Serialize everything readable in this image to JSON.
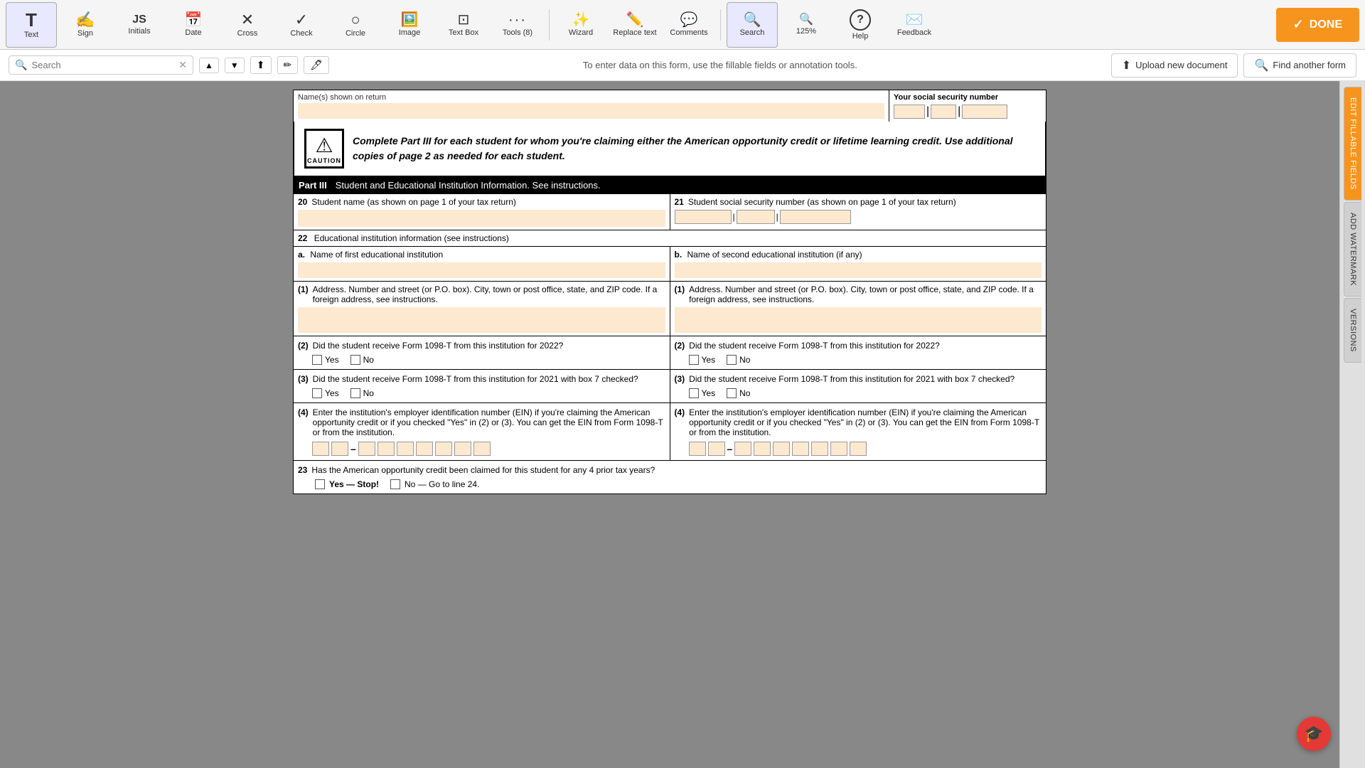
{
  "toolbar": {
    "tools": [
      {
        "id": "text",
        "label": "Text",
        "icon": "T",
        "active": true
      },
      {
        "id": "sign",
        "label": "Sign",
        "icon": "✍",
        "active": false
      },
      {
        "id": "initials",
        "label": "Initials",
        "icon": "JS",
        "active": false
      },
      {
        "id": "date",
        "label": "Date",
        "icon": "📅",
        "active": false
      },
      {
        "id": "cross",
        "label": "Cross",
        "icon": "✕",
        "active": false
      },
      {
        "id": "check",
        "label": "Check",
        "icon": "✓",
        "active": false
      },
      {
        "id": "circle",
        "label": "Circle",
        "icon": "○",
        "active": false
      },
      {
        "id": "image",
        "label": "Image",
        "icon": "🖼",
        "active": false
      },
      {
        "id": "textbox",
        "label": "Text Box",
        "icon": "⊞",
        "active": false
      },
      {
        "id": "tools",
        "label": "Tools (8)",
        "icon": "···",
        "active": false
      }
    ],
    "wizard": {
      "label": "Wizard",
      "icon": "✨"
    },
    "replace_text": {
      "label": "Replace text",
      "icon": "✎"
    },
    "comments": {
      "label": "Comments",
      "icon": "💬"
    },
    "search": {
      "label": "Search",
      "icon": "🔍",
      "active": true
    },
    "zoom": {
      "label": "125%",
      "icon": "🔍"
    },
    "help": {
      "label": "Help",
      "icon": "?"
    },
    "feedback": {
      "label": "Feedback",
      "icon": "✉"
    },
    "done_label": "DONE"
  },
  "searchbar": {
    "placeholder": "Search",
    "hint": "To enter data on this form, use the fillable fields or annotation tools.",
    "upload_label": "Upload new document",
    "find_label": "Find another form"
  },
  "sidebar_tabs": [
    {
      "label": "EDIT FILLABLE FIELDS",
      "color": "orange"
    },
    {
      "label": "ADD WATERMARK",
      "color": "normal"
    },
    {
      "label": "VERSIONS",
      "color": "normal"
    }
  ],
  "form": {
    "names_label": "Name(s) shown on return",
    "ssn_label": "Your social security number",
    "caution_text": "Complete Part III for each student for whom you're claiming either the American opportunity credit or lifetime learning credit. Use additional copies of page 2 as needed for each student.",
    "part_label": "Part III",
    "part_title": "Student and Educational Institution Information. See instructions.",
    "row20_num": "20",
    "row20_label": "Student name (as shown on page 1 of your tax return)",
    "row21_num": "21",
    "row21_label": "Student social security number (as shown on page 1 of your tax return)",
    "row22_num": "22",
    "row22_label": "Educational institution information (see instructions)",
    "col_a_label": "a.",
    "col_a_title": "Name of first educational institution",
    "col_b_label": "b.",
    "col_b_title": "Name of second educational institution (if any)",
    "addr1_label": "(1)",
    "addr1_text": "Address. Number and street (or P.O. box). City, town or post office, state, and ZIP code. If a foreign address, see instructions.",
    "q2_num": "(2)",
    "q2_text": "Did the student receive Form 1098-T from this institution for 2022?",
    "yes_label": "Yes",
    "no_label": "No",
    "q3_num": "(3)",
    "q3_text": "Did the student receive Form 1098-T from this institution for 2021 with box 7 checked?",
    "q4_num": "(4)",
    "q4_text": "Enter the institution's employer identification number (EIN) if you're claiming the American opportunity credit or if you checked \"Yes\" in (2) or (3). You can get the EIN from Form 1098-T or from the institution.",
    "row23_num": "23",
    "row23_text": "Has the American opportunity credit been claimed for this student for any 4 prior tax years?",
    "yes_stop_label": "Yes — Stop!",
    "no_goto_label": "No — Go to line 24."
  },
  "help_bubble": "🎓"
}
